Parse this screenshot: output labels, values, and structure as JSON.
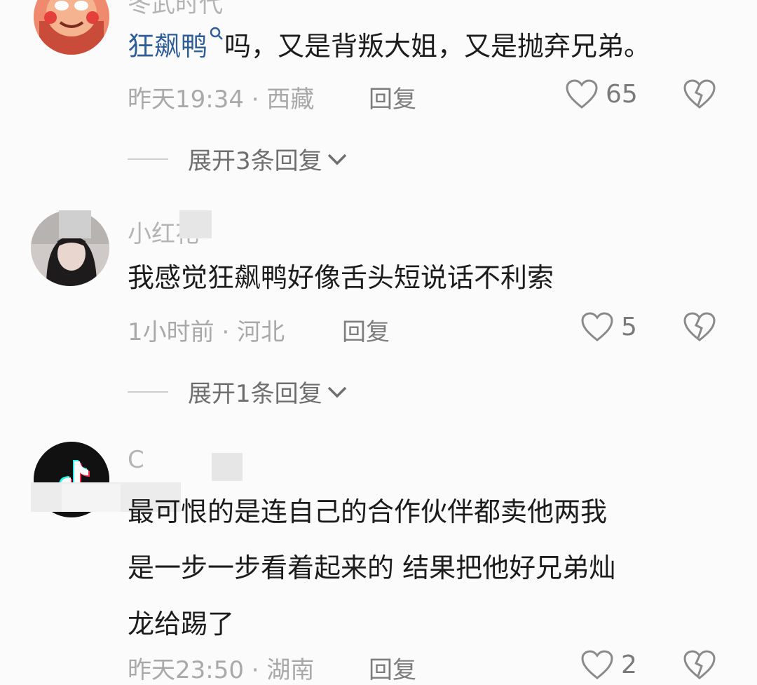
{
  "comments": [
    {
      "username": "冬武时代",
      "mention": "狂飙鸭",
      "text": "吗，又是背叛大姐，又是抛弃兄弟。",
      "time": "昨天19:34",
      "location": "西藏",
      "reply_label": "回复",
      "likes": "65",
      "expand_label": "展开3条回复"
    },
    {
      "username": "小红花",
      "text": "我感觉狂飙鸭好像舌头短说话不利索",
      "time": "1小时前",
      "location": "河北",
      "reply_label": "回复",
      "likes": "5",
      "expand_label": "展开1条回复"
    },
    {
      "username": "C",
      "text_lines": [
        "最可恨的是连自己的合作伙伴都卖他两我",
        "是一步一步看着起来的 结果把他好兄弟灿",
        "龙给踢了"
      ],
      "time": "昨天23:50",
      "location": "湖南",
      "reply_label": "回复",
      "likes": "2"
    }
  ],
  "separator": "·",
  "icons": [
    "heart-icon",
    "dislike-broken-heart-icon",
    "chevron-down-icon",
    "search-icon",
    "tiktok-logo-icon"
  ],
  "colors": {
    "mention": "#2f5d9a",
    "meta": "#a9a9a9",
    "background": "#fbfbfb"
  }
}
